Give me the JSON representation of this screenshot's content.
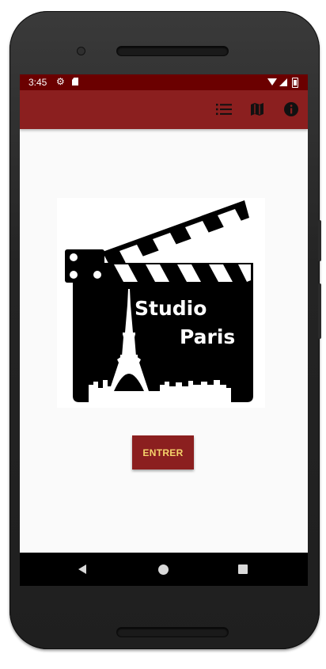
{
  "status_bar": {
    "time": "3:45",
    "icons": [
      "gear-icon",
      "sd-card-icon",
      "wifi-icon",
      "signal-icon",
      "battery-icon"
    ]
  },
  "app_bar": {
    "color": "#8b1f1f",
    "actions": [
      "list-icon",
      "map-icon",
      "info-icon"
    ]
  },
  "logo": {
    "line1": "Studio",
    "line2": "Paris"
  },
  "enter_button": {
    "label": "ENTRER",
    "bg_color": "#8b1f1f",
    "text_color": "#f5d36b"
  },
  "nav_bar": {
    "icons": [
      "back-icon",
      "home-icon",
      "recents-icon"
    ]
  }
}
